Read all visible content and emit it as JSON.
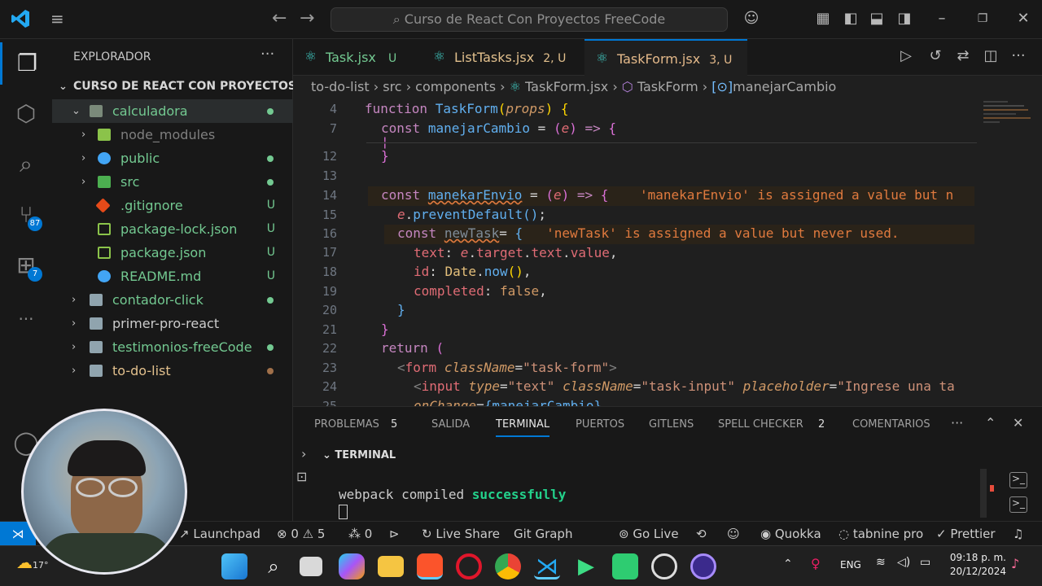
{
  "titlebar": {
    "search": "Curso de React Con Proyectos FreeCode"
  },
  "activity": {
    "source_badge": "87",
    "ext_badge": "7"
  },
  "explorer": {
    "header": "EXPLORADOR",
    "root": "CURSO DE REACT CON PROYECTOS F...",
    "items": [
      {
        "label": "calculadora",
        "status": ""
      },
      {
        "label": "node_modules",
        "status": ""
      },
      {
        "label": "public",
        "status": ""
      },
      {
        "label": "src",
        "status": ""
      },
      {
        "label": ".gitignore",
        "status": "U"
      },
      {
        "label": "package-lock.json",
        "status": "U"
      },
      {
        "label": "package.json",
        "status": "U"
      },
      {
        "label": "README.md",
        "status": "U"
      },
      {
        "label": "contador-click",
        "status": ""
      },
      {
        "label": "primer-pro-react",
        "status": ""
      },
      {
        "label": "testimonios-freeCode",
        "status": ""
      },
      {
        "label": "to-do-list",
        "status": ""
      }
    ]
  },
  "tabs": [
    {
      "label": "Task.jsx",
      "badge": "U"
    },
    {
      "label": "ListTasks.jsx",
      "badge": "2, U"
    },
    {
      "label": "TaskForm.jsx",
      "badge": "3, U"
    }
  ],
  "breadcrumb": [
    "to-do-list",
    "src",
    "components",
    "TaskForm.jsx",
    "TaskForm",
    "manejarCambio"
  ],
  "editor": {
    "line_numbers": [
      "4",
      "7",
      "12",
      "13",
      "14",
      "15",
      "16",
      "17",
      "18",
      "19",
      "20",
      "21",
      "22",
      "23",
      "24",
      "25"
    ],
    "warn1": "'manekarEnvio' is assigned a value but n",
    "warn2": "'newTask' is assigned a value but never used."
  },
  "panel": {
    "tabs": [
      "PROBLEMAS",
      "SALIDA",
      "TERMINAL",
      "PUERTOS",
      "GITLENS",
      "SPELL CHECKER",
      "COMENTARIOS"
    ],
    "problems_count": "5",
    "spell_count": "2",
    "section": "TERMINAL",
    "output_1": "webpack compiled ",
    "output_2": "successfully"
  },
  "status": {
    "launchpad": "Launchpad",
    "errors": "0",
    "warnings": "5",
    "ports": "0",
    "liveshare": "Live Share",
    "gitgraph": "Git Graph",
    "golive": "Go Live",
    "quokka": "Quokka",
    "tabnine": "tabnine pro",
    "prettier": "Prettier"
  },
  "taskbar": {
    "temp": "17°",
    "lang": "ENG",
    "time": "09:18 p. m.",
    "date": "20/12/2024"
  }
}
